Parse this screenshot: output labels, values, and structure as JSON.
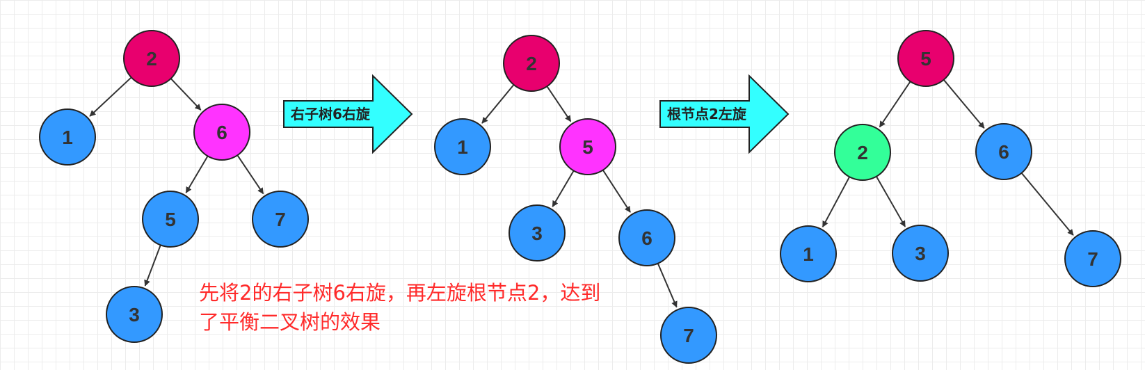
{
  "colors": {
    "blue": "#3399ff",
    "crimson": "#e8006e",
    "magenta": "#ff33ff",
    "green": "#33ff99",
    "arrow_fill": "#33ffff",
    "note_text": "#ff2a2a"
  },
  "trees": [
    {
      "name": "original",
      "nodes": [
        {
          "label": "2",
          "color": "crimson"
        },
        {
          "label": "1",
          "color": "blue"
        },
        {
          "label": "6",
          "color": "magenta"
        },
        {
          "label": "5",
          "color": "blue"
        },
        {
          "label": "7",
          "color": "blue"
        },
        {
          "label": "3",
          "color": "blue"
        }
      ]
    },
    {
      "name": "after-right-rotation",
      "nodes": [
        {
          "label": "2",
          "color": "crimson"
        },
        {
          "label": "1",
          "color": "blue"
        },
        {
          "label": "5",
          "color": "magenta"
        },
        {
          "label": "3",
          "color": "blue"
        },
        {
          "label": "6",
          "color": "blue"
        },
        {
          "label": "7",
          "color": "blue"
        }
      ]
    },
    {
      "name": "after-left-rotation",
      "nodes": [
        {
          "label": "5",
          "color": "crimson"
        },
        {
          "label": "2",
          "color": "green"
        },
        {
          "label": "6",
          "color": "blue"
        },
        {
          "label": "1",
          "color": "blue"
        },
        {
          "label": "3",
          "color": "blue"
        },
        {
          "label": "7",
          "color": "blue"
        }
      ]
    }
  ],
  "arrows": [
    {
      "label": "右子树6右旋"
    },
    {
      "label": "根节点2左旋"
    }
  ],
  "note": {
    "line1": "先将2的右子树6右旋，再左旋根节点2，达到",
    "line2": "了平衡二叉树的效果"
  }
}
